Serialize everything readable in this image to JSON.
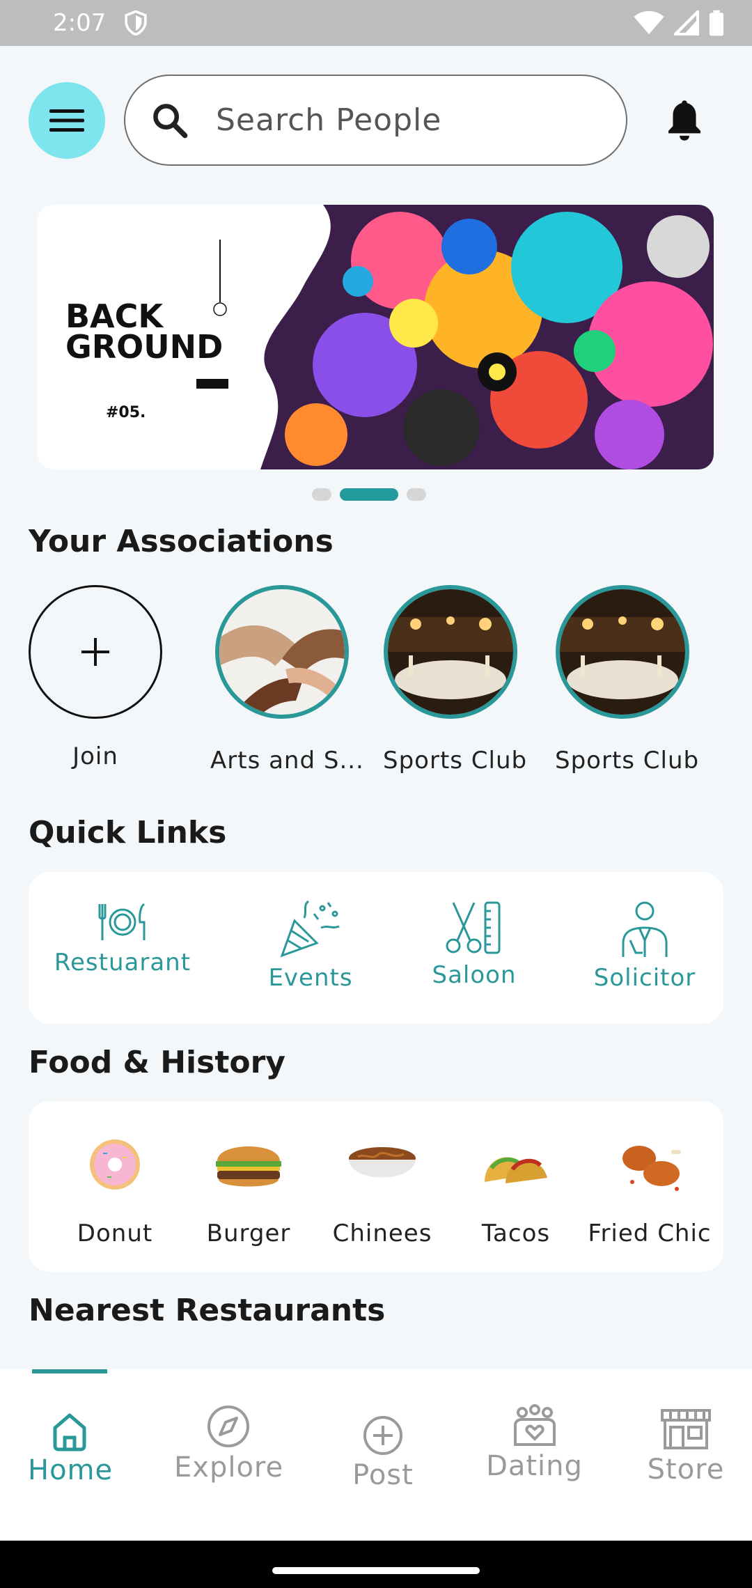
{
  "status_bar": {
    "time": "2:07"
  },
  "header": {
    "search_placeholder": "Search People"
  },
  "banner": {
    "title": "BACK\nGROUND",
    "code": "#05.",
    "active_slide": 2,
    "slide_count": 3
  },
  "associations": {
    "title": "Your Associations",
    "items": [
      {
        "label": "Join"
      },
      {
        "label": "Arts and S..."
      },
      {
        "label": "Sports Club"
      },
      {
        "label": "Sports Club"
      }
    ]
  },
  "quick_links": {
    "title": "Quick Links",
    "items": [
      {
        "label": "Restuarant",
        "icon": "fork-plate-knife-icon"
      },
      {
        "label": "Events",
        "icon": "party-popper-icon"
      },
      {
        "label": "Saloon",
        "icon": "scissors-comb-icon"
      },
      {
        "label": "Solicitor",
        "icon": "lawyer-icon"
      }
    ]
  },
  "food": {
    "title": "Food & History",
    "items": [
      {
        "label": "Donut"
      },
      {
        "label": "Burger"
      },
      {
        "label": "Chinees"
      },
      {
        "label": "Tacos"
      },
      {
        "label": "Fried Chic"
      }
    ]
  },
  "nearest": {
    "title": "Nearest Restaurants"
  },
  "bottom_nav": {
    "items": [
      {
        "label": "Home",
        "icon": "home-icon",
        "active": true
      },
      {
        "label": "Explore",
        "icon": "compass-icon"
      },
      {
        "label": "Post",
        "icon": "plus-circle-icon"
      },
      {
        "label": "Dating",
        "icon": "dating-icon"
      },
      {
        "label": "Store",
        "icon": "store-icon"
      }
    ]
  },
  "colors": {
    "accent": "#2a9799",
    "menu_bg": "#7ee5ee",
    "page_bg": "#f3f7f9"
  }
}
